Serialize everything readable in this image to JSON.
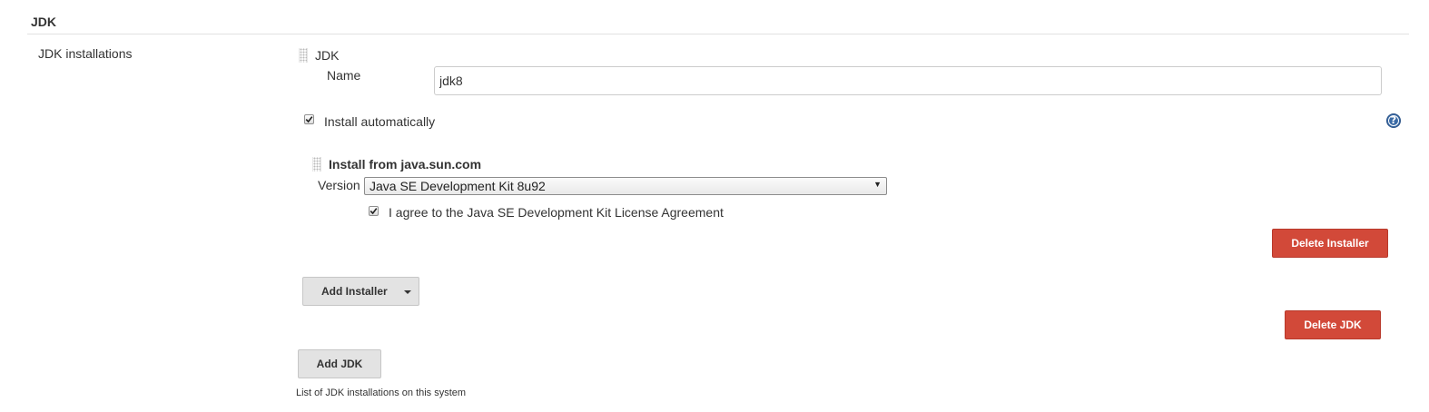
{
  "section": {
    "title": "JDK"
  },
  "jdk_installations": {
    "label": "JDK installations",
    "description": "List of JDK installations on this system",
    "add_jdk_label": "Add JDK",
    "jdk": {
      "header": "JDK",
      "name_label": "Name",
      "name_value": "jdk8",
      "install_auto_label": "Install automatically",
      "install_auto_checked": true,
      "help_icon": "question-mark-icon",
      "installer": {
        "title": "Install from java.sun.com",
        "version_label": "Version",
        "version_selected": "Java SE Development Kit 8u92",
        "license_label": "I agree to the Java SE Development Kit License Agreement",
        "license_checked": true,
        "delete_installer_label": "Delete Installer"
      },
      "add_installer_label": "Add Installer",
      "delete_jdk_label": "Delete JDK"
    }
  },
  "colors": {
    "delete_button": "#d24939",
    "neutral_button": "#e3e3e3",
    "help_icon": "#3a6aa5"
  }
}
